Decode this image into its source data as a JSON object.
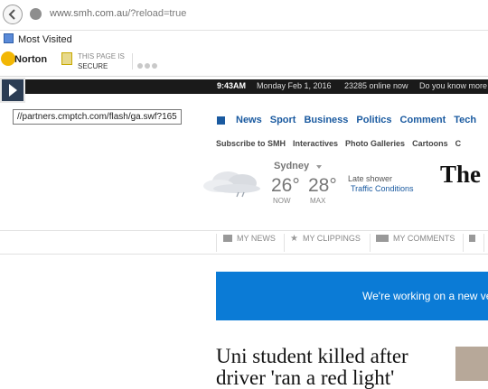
{
  "browser": {
    "url_host": "www.smh.com.au",
    "url_path": "/?reload=true",
    "bookmark": "Most Visited",
    "norton_label": "Norton",
    "secure_line1": "THIS PAGE IS",
    "secure_line2": "SECURE",
    "tooltip": "//partners.cmptch.com/flash/ga.swf?165"
  },
  "topstrip": {
    "time": "9:43AM",
    "date": "Monday Feb 1, 2016",
    "online": "23285 online now",
    "promo": "Do you know more"
  },
  "nav": [
    "News",
    "Sport",
    "Business",
    "Politics",
    "Comment",
    "Tech"
  ],
  "subnav": [
    "Subscribe to SMH",
    "Interactives",
    "Photo Galleries",
    "Cartoons",
    "C"
  ],
  "weather": {
    "city": "Sydney",
    "now_temp": "26°",
    "now_label": "NOW",
    "max_temp": "28°",
    "max_label": "MAX",
    "forecast": "Late shower",
    "traffic": "Traffic Conditions"
  },
  "masthead": "The S",
  "userbar": [
    "MY NEWS",
    "MY CLIPPINGS",
    "MY COMMENTS"
  ],
  "banner": "We're working on a new ve",
  "headline": "Uni student killed after driver 'ran a red light'"
}
